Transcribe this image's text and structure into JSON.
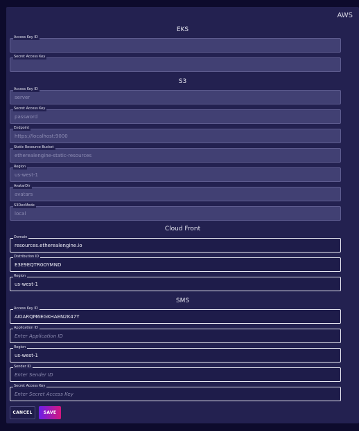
{
  "panel": {
    "title": "AWS"
  },
  "sections": {
    "eks": {
      "title": "EKS",
      "fields": [
        {
          "label": "Access Key ID",
          "value": ""
        },
        {
          "label": "Secret Access Key",
          "value": ""
        }
      ]
    },
    "s3": {
      "title": "S3",
      "fields": [
        {
          "label": "Access Key ID",
          "value": "server"
        },
        {
          "label": "Secret Access Key",
          "value": "password"
        },
        {
          "label": "Endpoint",
          "value": "https://localhost:9000"
        },
        {
          "label": "Static Resource Bucket",
          "value": "etherealengine-static-resources"
        },
        {
          "label": "Region",
          "value": "us-west-1"
        },
        {
          "label": "AvatarDir",
          "value": "avatars"
        },
        {
          "label": "S3DevMode",
          "value": "local"
        }
      ]
    },
    "cloudfront": {
      "title": "Cloud Front",
      "fields": [
        {
          "label": "Domain",
          "value": "resources.etherealengine.io"
        },
        {
          "label": "Distribution ID",
          "value": "E3E9EQTR0OYMND"
        },
        {
          "label": "Region",
          "value": "us-west-1"
        }
      ]
    },
    "sms": {
      "title": "SMS",
      "fields": [
        {
          "label": "Access Key ID",
          "value": "AKIARQM6EGKHAEN2K47Y",
          "placeholder": ""
        },
        {
          "label": "Application ID",
          "value": "",
          "placeholder": "Enter Application ID"
        },
        {
          "label": "Region",
          "value": "us-west-1",
          "placeholder": ""
        },
        {
          "label": "Sender ID",
          "value": "",
          "placeholder": "Enter Sender ID"
        },
        {
          "label": "Secret Access Key",
          "value": "",
          "placeholder": "Enter Secret Access Key"
        }
      ]
    }
  },
  "actions": {
    "cancel_label": "CANCEL",
    "save_label": "SAVE"
  },
  "colors": {
    "background": "#0d0b2c",
    "panel": "#232150",
    "disabled_field": "#414073",
    "active_field_border": "#e8e8f2",
    "save_gradient_start": "#6a1ee8",
    "save_gradient_end": "#d4187f"
  }
}
